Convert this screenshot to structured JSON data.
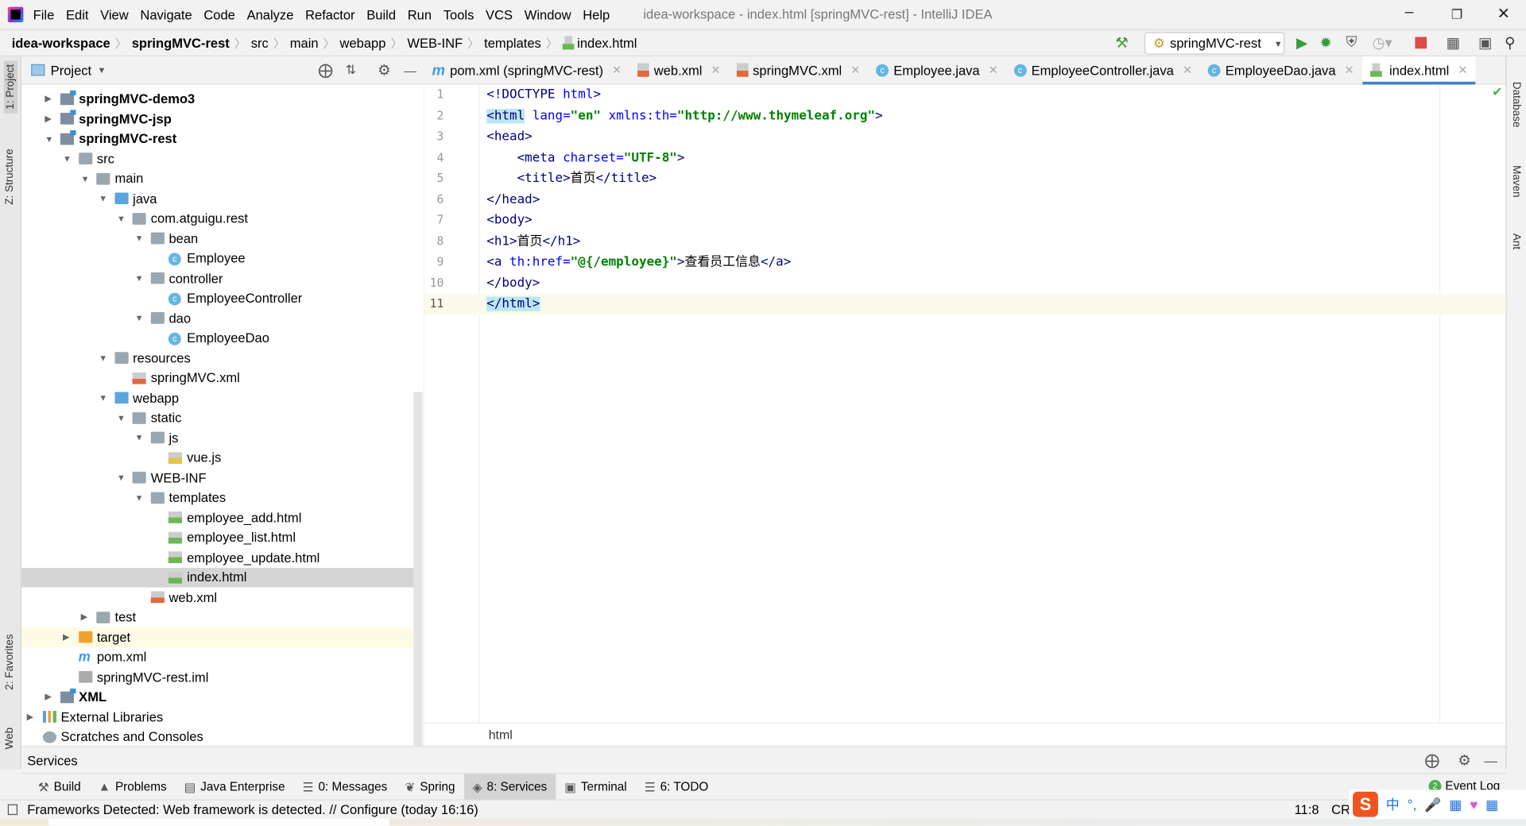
{
  "menubar": {
    "items": [
      "File",
      "Edit",
      "View",
      "Navigate",
      "Code",
      "Analyze",
      "Refactor",
      "Build",
      "Run",
      "Tools",
      "VCS",
      "Window",
      "Help"
    ],
    "title": "idea-workspace - index.html [springMVC-rest] - IntelliJ IDEA"
  },
  "breadcrumb": [
    "idea-workspace",
    "springMVC-rest",
    "src",
    "main",
    "webapp",
    "WEB-INF",
    "templates",
    "index.html"
  ],
  "run_config": "springMVC-rest",
  "left_strip": {
    "project": "1: Project",
    "structure": "Z: Structure",
    "favorites": "2: Favorites",
    "web": "Web"
  },
  "right_strip": {
    "database": "Database",
    "maven": "Maven",
    "ant": "Ant"
  },
  "project_panel": {
    "title": "Project"
  },
  "tree": [
    {
      "l": 0,
      "t": "springMVC-demo3",
      "i": "module",
      "a": "c",
      "b": true
    },
    {
      "l": 0,
      "t": "springMVC-jsp",
      "i": "module",
      "a": "c",
      "b": true
    },
    {
      "l": 0,
      "t": "springMVC-rest",
      "i": "module",
      "a": "e",
      "b": true
    },
    {
      "l": 1,
      "t": "src",
      "i": "folder",
      "a": "e"
    },
    {
      "l": 2,
      "t": "main",
      "i": "folder",
      "a": "e"
    },
    {
      "l": 3,
      "t": "java",
      "i": "folder blue",
      "a": "e"
    },
    {
      "l": 4,
      "t": "com.atguigu.rest",
      "i": "folder",
      "a": "e"
    },
    {
      "l": 5,
      "t": "bean",
      "i": "folder",
      "a": "e"
    },
    {
      "l": 6,
      "t": "Employee",
      "i": "cls"
    },
    {
      "l": 5,
      "t": "controller",
      "i": "folder",
      "a": "e"
    },
    {
      "l": 6,
      "t": "EmployeeController",
      "i": "cls"
    },
    {
      "l": 5,
      "t": "dao",
      "i": "folder",
      "a": "e"
    },
    {
      "l": 6,
      "t": "EmployeeDao",
      "i": "cls"
    },
    {
      "l": 3,
      "t": "resources",
      "i": "folder",
      "a": "e"
    },
    {
      "l": 4,
      "t": "springMVC.xml",
      "i": "xml"
    },
    {
      "l": 3,
      "t": "webapp",
      "i": "folder blue",
      "a": "e"
    },
    {
      "l": 4,
      "t": "static",
      "i": "folder",
      "a": "e"
    },
    {
      "l": 5,
      "t": "js",
      "i": "folder",
      "a": "e"
    },
    {
      "l": 6,
      "t": "vue.js",
      "i": "js"
    },
    {
      "l": 4,
      "t": "WEB-INF",
      "i": "folder",
      "a": "e"
    },
    {
      "l": 5,
      "t": "templates",
      "i": "folder",
      "a": "e"
    },
    {
      "l": 6,
      "t": "employee_add.html",
      "i": "html"
    },
    {
      "l": 6,
      "t": "employee_list.html",
      "i": "html"
    },
    {
      "l": 6,
      "t": "employee_update.html",
      "i": "html"
    },
    {
      "l": 6,
      "t": "index.html",
      "i": "html",
      "sel": true
    },
    {
      "l": 5,
      "t": "web.xml",
      "i": "xml"
    },
    {
      "l": 2,
      "t": "test",
      "i": "folder",
      "a": "c"
    },
    {
      "l": 1,
      "t": "target",
      "i": "folder orange",
      "a": "c",
      "hl": true
    },
    {
      "l": 1,
      "t": "pom.xml",
      "i": "pom"
    },
    {
      "l": 1,
      "t": "springMVC-rest.iml",
      "i": "iml"
    },
    {
      "l": 0,
      "t": "XML",
      "i": "module",
      "a": "c",
      "b": true
    },
    {
      "l": -1,
      "t": "External Libraries",
      "i": "lib",
      "a": "c"
    },
    {
      "l": -1,
      "t": "Scratches and Consoles",
      "i": "scr"
    }
  ],
  "tabs": [
    {
      "label": "pom.xml (springMVC-rest)",
      "icon": "maven"
    },
    {
      "label": "web.xml",
      "icon": "xml"
    },
    {
      "label": "springMVC.xml",
      "icon": "xml"
    },
    {
      "label": "Employee.java",
      "icon": "class"
    },
    {
      "label": "EmployeeController.java",
      "icon": "class"
    },
    {
      "label": "EmployeeDao.java",
      "icon": "class"
    },
    {
      "label": "index.html",
      "icon": "html",
      "active": true
    }
  ],
  "code": [
    [
      {
        "t": "<!DOCTYPE ",
        "c": "tag"
      },
      {
        "t": "html",
        "c": "attr"
      },
      {
        "t": ">",
        "c": "tag"
      }
    ],
    [
      {
        "t": "<html",
        "c": "tag hlt"
      },
      {
        "t": " lang=",
        "c": "attr"
      },
      {
        "t": "\"en\"",
        "c": "str"
      },
      {
        "t": " xmlns:th=",
        "c": "attr"
      },
      {
        "t": "\"http://www.thymeleaf.org\"",
        "c": "str"
      },
      {
        "t": ">",
        "c": "tag"
      }
    ],
    [
      {
        "t": "<head>",
        "c": "tag"
      }
    ],
    [
      {
        "t": "    <meta",
        "c": "tag"
      },
      {
        "t": " charset=",
        "c": "attr"
      },
      {
        "t": "\"UTF-8\"",
        "c": "str"
      },
      {
        "t": ">",
        "c": "tag"
      }
    ],
    [
      {
        "t": "    <title>",
        "c": "tag"
      },
      {
        "t": "首页",
        "c": "plain"
      },
      {
        "t": "</title>",
        "c": "tag"
      }
    ],
    [
      {
        "t": "</head>",
        "c": "tag"
      }
    ],
    [
      {
        "t": "<body>",
        "c": "tag"
      }
    ],
    [
      {
        "t": "<h1>",
        "c": "tag"
      },
      {
        "t": "首页",
        "c": "plain"
      },
      {
        "t": "</h1>",
        "c": "tag"
      }
    ],
    [
      {
        "t": "<a",
        "c": "tag"
      },
      {
        "t": " th:href=",
        "c": "attr"
      },
      {
        "t": "\"@{/employee}\"",
        "c": "str"
      },
      {
        "t": ">",
        "c": "tag"
      },
      {
        "t": "查看员工信息",
        "c": "plain"
      },
      {
        "t": "</a>",
        "c": "tag"
      }
    ],
    [
      {
        "t": "</body>",
        "c": "tag"
      }
    ],
    [
      {
        "t": "</html>",
        "c": "tag hlt"
      }
    ]
  ],
  "current_line": 11,
  "editor_breadcrumb": "html",
  "services_title": "Services",
  "tool_windows": [
    {
      "label": "Build",
      "icon": "hammer"
    },
    {
      "label": "Problems",
      "icon": "warning"
    },
    {
      "label": "Java Enterprise",
      "icon": "jee"
    },
    {
      "label": "0: Messages",
      "icon": "messages"
    },
    {
      "label": "Spring",
      "icon": "spring"
    },
    {
      "label": "8: Services",
      "icon": "services",
      "active": true
    },
    {
      "label": "Terminal",
      "icon": "terminal"
    },
    {
      "label": "6: TODO",
      "icon": "todo"
    }
  ],
  "event_log": {
    "label": "Event Log",
    "count": "2"
  },
  "status": {
    "message": "Frameworks Detected: Web framework is detected. // Configure (today 16:16)",
    "position": "11:8",
    "line_sep": "CRLF"
  },
  "ime": {
    "lang": "中"
  }
}
